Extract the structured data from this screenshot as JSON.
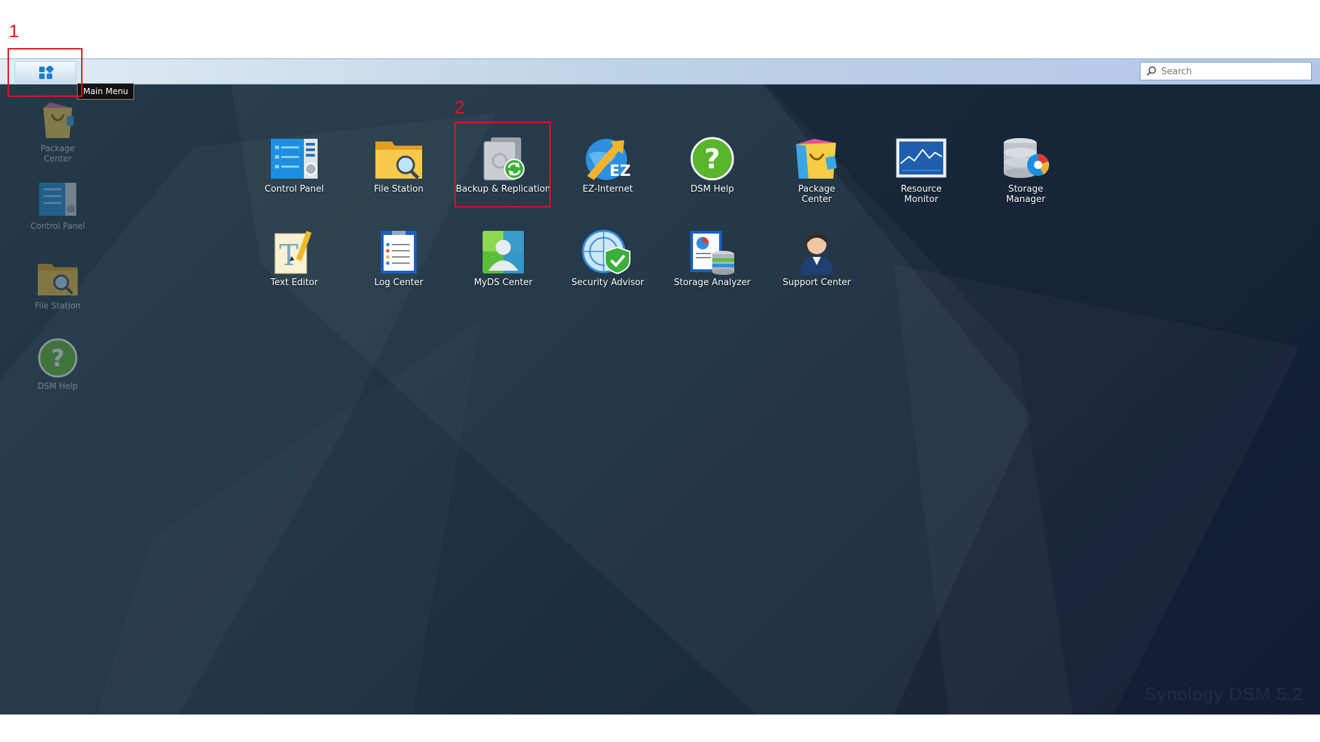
{
  "annotations": {
    "step1": "1",
    "step2": "2"
  },
  "taskbar": {
    "main_menu_tooltip": "Main Menu",
    "search_placeholder": "Search"
  },
  "desktop_shortcuts": [
    {
      "label": "Package\nCenter"
    },
    {
      "label": "Control Panel"
    },
    {
      "label": "File Station"
    },
    {
      "label": "DSM Help"
    }
  ],
  "main_menu": {
    "apps": [
      {
        "label": "Control Panel"
      },
      {
        "label": "File Station"
      },
      {
        "label": "Backup & Replication"
      },
      {
        "label": "EZ-Internet"
      },
      {
        "label": "DSM Help"
      },
      {
        "label": "Package\nCenter"
      },
      {
        "label": "Resource\nMonitor"
      },
      {
        "label": "Storage\nManager"
      },
      {
        "label": "Text Editor"
      },
      {
        "label": "Log Center"
      },
      {
        "label": "MyDS Center"
      },
      {
        "label": "Security Advisor"
      },
      {
        "label": "Storage Analyzer"
      },
      {
        "label": "Support Center"
      }
    ]
  },
  "watermark": "Synology DSM 5.2",
  "colors": {
    "annotation": "#e0141e",
    "accent": "#1a7fd4"
  }
}
